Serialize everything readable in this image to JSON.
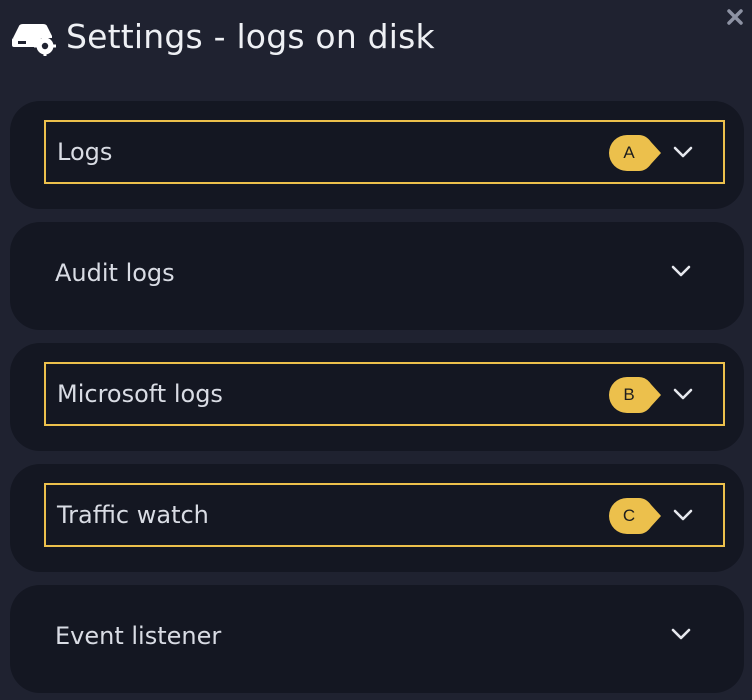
{
  "window": {
    "title": "Settings - logs on disk",
    "icon": "server-settings-icon",
    "close_icon": "close-icon"
  },
  "colors": {
    "background": "#1f2230",
    "panel": "#141722",
    "highlight": "#ecc04c",
    "text": "#d9dce4"
  },
  "sections": [
    {
      "label": "Logs",
      "badge": "A",
      "highlighted": true,
      "expand_icon": "chevron-down-icon"
    },
    {
      "label": "Audit logs",
      "badge": "",
      "highlighted": false,
      "expand_icon": "chevron-down-icon"
    },
    {
      "label": "Microsoft logs",
      "badge": "B",
      "highlighted": true,
      "expand_icon": "chevron-down-icon"
    },
    {
      "label": "Traffic watch",
      "badge": "C",
      "highlighted": true,
      "expand_icon": "chevron-down-icon"
    },
    {
      "label": "Event listener",
      "badge": "",
      "highlighted": false,
      "expand_icon": "chevron-down-icon"
    }
  ]
}
